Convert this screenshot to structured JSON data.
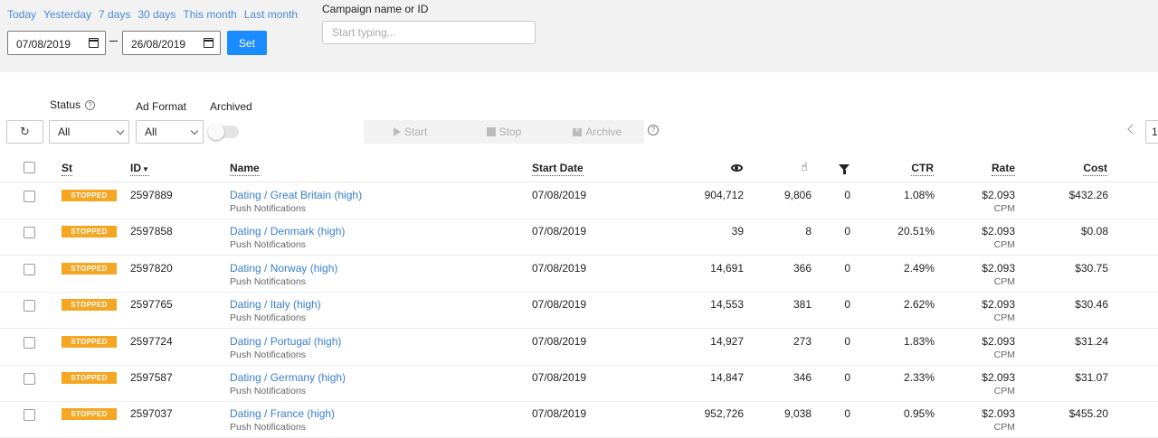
{
  "quick_ranges": [
    "Today",
    "Yesterday",
    "7 days",
    "30 days",
    "This month",
    "Last month"
  ],
  "date_from": "07/08/2019",
  "date_to": "26/08/2019",
  "set_label": "Set",
  "search": {
    "label": "Campaign name or ID",
    "placeholder": "Start typing..."
  },
  "filters": {
    "status_label": "Status",
    "status_value": "All",
    "adformat_label": "Ad Format",
    "adformat_value": "All",
    "archived_label": "Archived",
    "archived_on": false
  },
  "actions": {
    "start": "Start",
    "stop": "Stop",
    "archive": "Archive"
  },
  "pagination": {
    "page": "1"
  },
  "columns": {
    "st": "St",
    "id": "ID",
    "name": "Name",
    "start_date": "Start Date",
    "impressions_icon": "eye-icon",
    "clicks_icon": "click-icon",
    "conversions_icon": "funnel-icon",
    "ctr": "CTR",
    "rate": "Rate",
    "cost": "Cost"
  },
  "status_color": "#f5a623",
  "link_color": "#3a7fd0",
  "rows": [
    {
      "status": "STOPPED",
      "id": "2597889",
      "name": "Dating / Great Britain (high)",
      "format": "Push Notifications",
      "start": "07/08/2019",
      "impressions": "904,712",
      "clicks": "9,806",
      "conversions": "0",
      "ctr": "1.08%",
      "rate": "$2.093",
      "rate_unit": "CPM",
      "cost": "$432.26"
    },
    {
      "status": "STOPPED",
      "id": "2597858",
      "name": "Dating / Denmark (high)",
      "format": "Push Notifications",
      "start": "07/08/2019",
      "impressions": "39",
      "clicks": "8",
      "conversions": "0",
      "ctr": "20.51%",
      "rate": "$2.093",
      "rate_unit": "CPM",
      "cost": "$0.08"
    },
    {
      "status": "STOPPED",
      "id": "2597820",
      "name": "Dating / Norway (high)",
      "format": "Push Notifications",
      "start": "07/08/2019",
      "impressions": "14,691",
      "clicks": "366",
      "conversions": "0",
      "ctr": "2.49%",
      "rate": "$2.093",
      "rate_unit": "CPM",
      "cost": "$30.75"
    },
    {
      "status": "STOPPED",
      "id": "2597765",
      "name": "Dating / Italy (high)",
      "format": "Push Notifications",
      "start": "07/08/2019",
      "impressions": "14,553",
      "clicks": "381",
      "conversions": "0",
      "ctr": "2.62%",
      "rate": "$2.093",
      "rate_unit": "CPM",
      "cost": "$30.46"
    },
    {
      "status": "STOPPED",
      "id": "2597724",
      "name": "Dating / Portugal (high)",
      "format": "Push Notifications",
      "start": "07/08/2019",
      "impressions": "14,927",
      "clicks": "273",
      "conversions": "0",
      "ctr": "1.83%",
      "rate": "$2.093",
      "rate_unit": "CPM",
      "cost": "$31.24"
    },
    {
      "status": "STOPPED",
      "id": "2597587",
      "name": "Dating / Germany (high)",
      "format": "Push Notifications",
      "start": "07/08/2019",
      "impressions": "14,847",
      "clicks": "346",
      "conversions": "0",
      "ctr": "2.33%",
      "rate": "$2.093",
      "rate_unit": "CPM",
      "cost": "$31.07"
    },
    {
      "status": "STOPPED",
      "id": "2597037",
      "name": "Dating / France (high)",
      "format": "Push Notifications",
      "start": "07/08/2019",
      "impressions": "952,726",
      "clicks": "9,038",
      "conversions": "0",
      "ctr": "0.95%",
      "rate": "$2.093",
      "rate_unit": "CPM",
      "cost": "$455.20"
    }
  ]
}
